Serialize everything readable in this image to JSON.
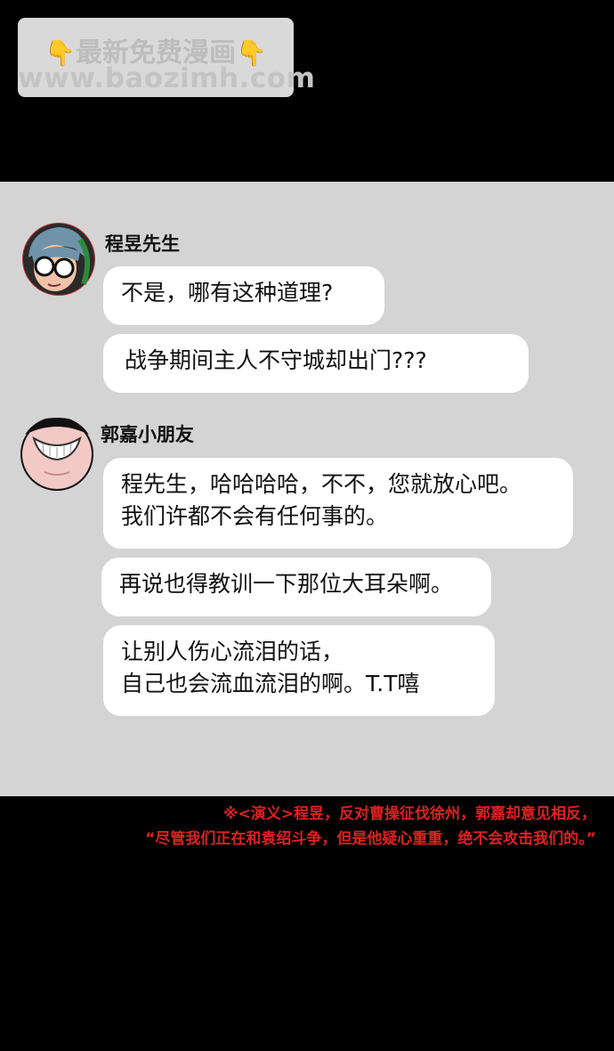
{
  "watermark": {
    "line1": "最新免费漫画",
    "line2": "www.baozimh.com",
    "hand_icon": "👇"
  },
  "chat": {
    "speaker1": {
      "name": "程昱先生",
      "messages": [
        "不是，哪有这种道理?",
        "战争期间主人不守城却出门???"
      ]
    },
    "speaker2": {
      "name": "郭嘉小朋友",
      "messages": [
        [
          "程先生，哈哈哈哈，不不，您就放心吧。",
          "我们许都不会有任何事的。"
        ],
        [
          "再说也得教训一下那位大耳朵啊。"
        ],
        [
          "让别人伤心流泪的话，",
          "自己也会流血流泪的啊。T.T嘻"
        ]
      ]
    }
  },
  "footnote": {
    "line1": "※<演义>程昱，反对曹操征伐徐州，郭嘉却意见相反，",
    "line2": "“尽管我们正在和袁绍斗争，但是他疑心重重，绝不会攻击我们的。”"
  },
  "colors": {
    "panel_bg": "#d4d4d4",
    "bubble_bg": "#ffffff",
    "footnote": "#e02020"
  }
}
